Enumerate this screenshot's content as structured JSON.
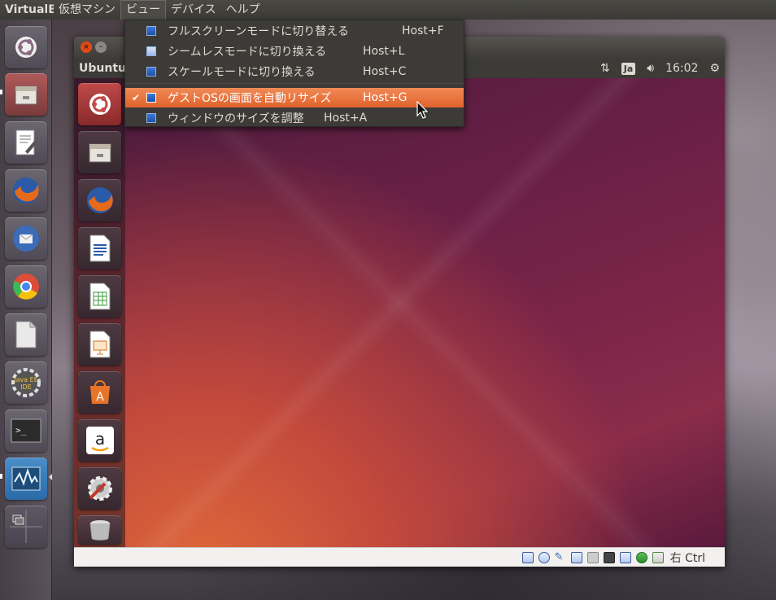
{
  "host": {
    "app_title": "VirtualBox",
    "menus": [
      "仮想マシン",
      "ビュー",
      "デバイス",
      "ヘルプ"
    ]
  },
  "vm": {
    "guest_title": "Ubuntu",
    "clock": "16:02",
    "keyboard": "Ja",
    "status": {
      "host_key": "右 Ctrl"
    }
  },
  "view_menu": {
    "items": [
      {
        "label": "フルスクリーンモードに切り替える",
        "shortcut": "Host+F",
        "checked": false
      },
      {
        "label": "シームレスモードに切り換える",
        "shortcut": "Host+L",
        "checked": false
      },
      {
        "label": "スケールモードに切り換える",
        "shortcut": "Host+C",
        "checked": false
      },
      {
        "label": "ゲストOSの画面を自動リサイズ",
        "shortcut": "Host+G",
        "checked": true
      },
      {
        "label": "ウィンドウのサイズを調整",
        "shortcut": "Host+A",
        "checked": false
      }
    ]
  },
  "colors": {
    "accent": "#e2622c",
    "panel": "#3c3b37",
    "guest_bg": "#6a2046"
  },
  "host_launcher_icons": [
    "ubuntu-dash-icon",
    "files-icon",
    "text-editor-icon",
    "firefox-icon",
    "thunderbird-icon",
    "chrome-icon",
    "libreoffice-icon",
    "java-ee-ide-icon",
    "terminal-icon",
    "system-monitor-icon",
    "workspace-switcher-icon"
  ],
  "guest_launcher_icons": [
    "ubuntu-dash-icon",
    "files-icon",
    "firefox-icon",
    "writer-icon",
    "calc-icon",
    "impress-icon",
    "software-center-icon",
    "amazon-icon",
    "system-settings-icon",
    "trash-icon"
  ]
}
